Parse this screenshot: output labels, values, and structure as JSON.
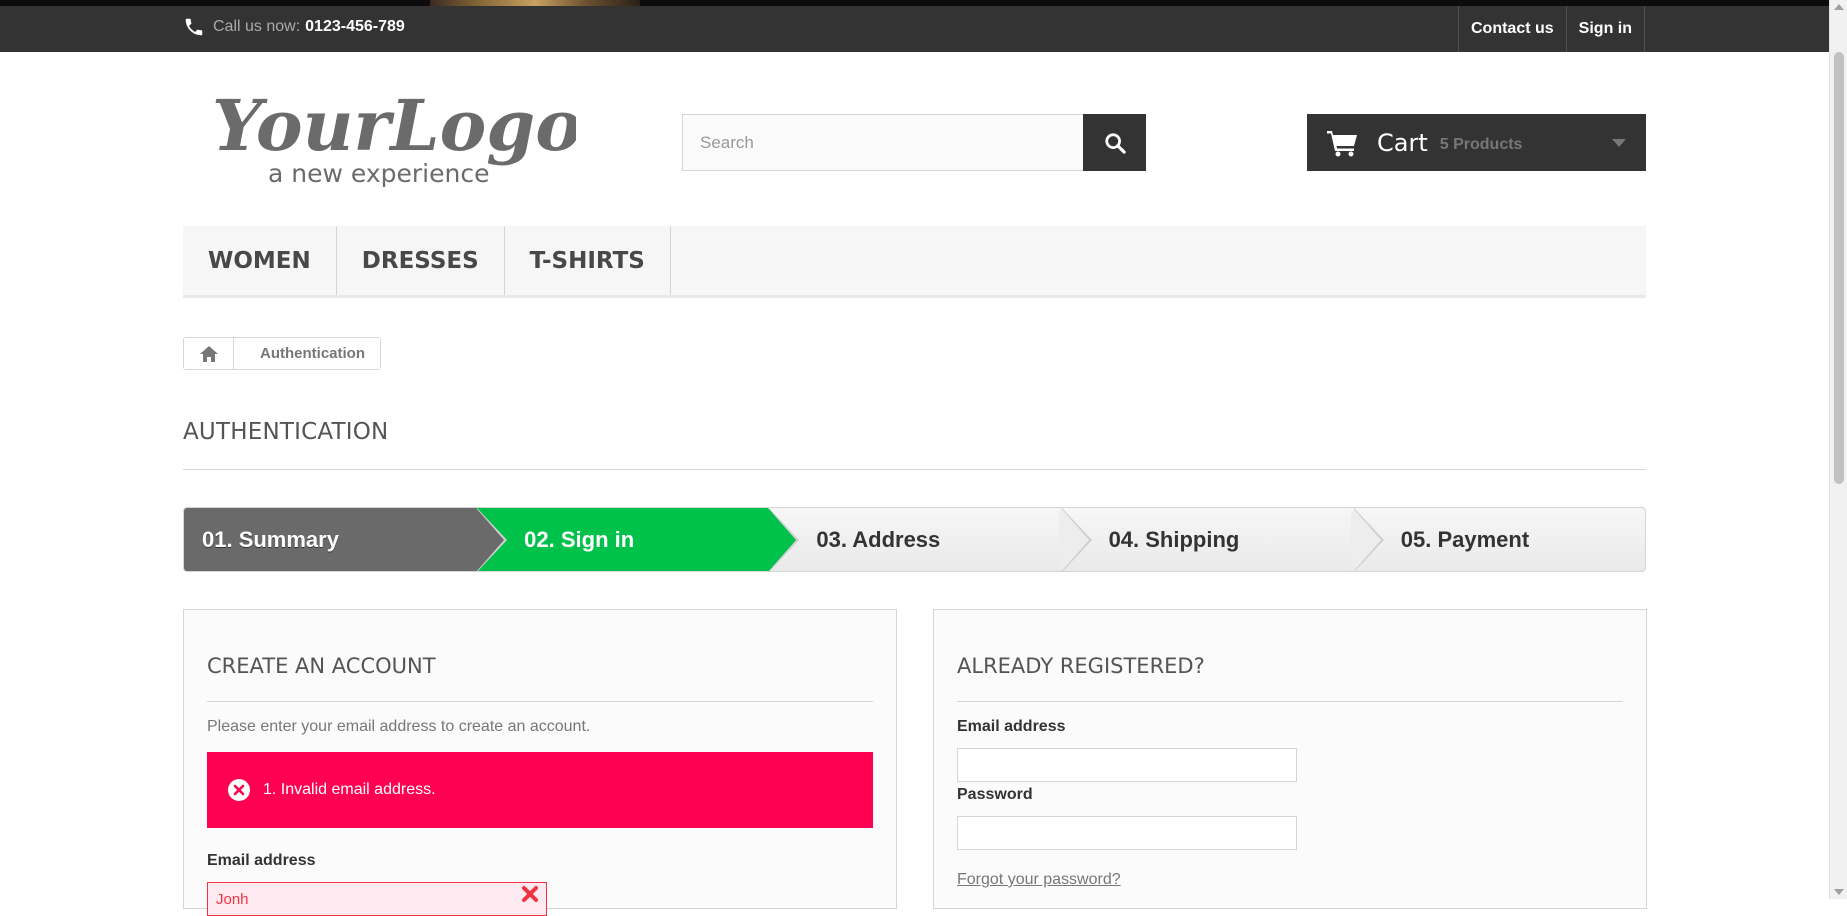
{
  "topbar": {
    "call_label": "Call us now:",
    "phone_number": "0123-456-789",
    "links": [
      "Contact us",
      "Sign in"
    ]
  },
  "header": {
    "logo_main": "YourLogo",
    "logo_tagline": "a new experience",
    "search_placeholder": "Search",
    "cart_label": "Cart",
    "cart_count": "5 Products"
  },
  "nav": {
    "items": [
      "WOMEN",
      "DRESSES",
      "T-SHIRTS"
    ]
  },
  "breadcrumb": {
    "current": "Authentication"
  },
  "page": {
    "title": "AUTHENTICATION"
  },
  "steps": [
    "01. Summary",
    "02. Sign in",
    "03. Address",
    "04. Shipping",
    "05. Payment"
  ],
  "create_account": {
    "heading": "CREATE AN ACCOUNT",
    "hint": "Please enter your email address to create an account.",
    "error": "1. Invalid email address.",
    "email_label": "Email address",
    "email_value": "Jonh"
  },
  "registered": {
    "heading": "ALREADY REGISTERED?",
    "email_label": "Email address",
    "email_value": "",
    "password_label": "Password",
    "password_value": "",
    "forgot": "Forgot your password?"
  },
  "colors": {
    "dark": "#333333",
    "active_step": "#00c24a",
    "done_step": "#6a6a6a",
    "alert": "#ff0052"
  }
}
